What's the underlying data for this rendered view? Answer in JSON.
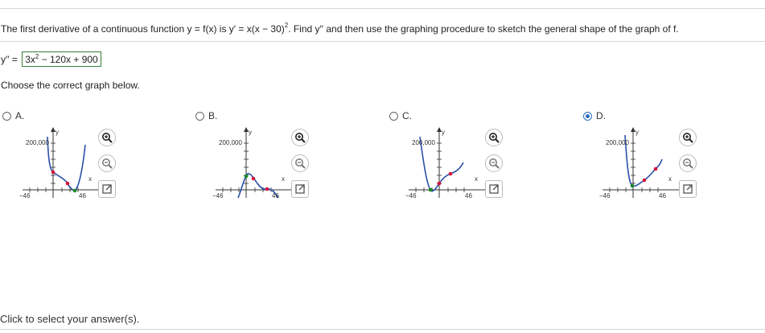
{
  "question": {
    "prefix": "The first derivative of a continuous function y = f(x) is y′ = x(x − 30)",
    "exponent": "2",
    "suffix": ". Find y′′ and then use the graphing procedure to sketch the general shape of the graph of f."
  },
  "answer": {
    "label": "y′′ =",
    "value_a": "3x",
    "value_exp": "2",
    "value_b": " − 120x + 900"
  },
  "instruction": "Choose the correct graph below.",
  "options": [
    {
      "letter": "A.",
      "selected": false,
      "ytick": "200,000",
      "xneg": "−46",
      "xpos": "46",
      "xlabel": "x",
      "ylabel": "y"
    },
    {
      "letter": "B.",
      "selected": false,
      "ytick": "200,000",
      "xneg": "−46",
      "xpos": "46",
      "xlabel": "x",
      "ylabel": "y"
    },
    {
      "letter": "C.",
      "selected": false,
      "ytick": "200,000",
      "xneg": "−46",
      "xpos": "46",
      "xlabel": "x",
      "ylabel": "y"
    },
    {
      "letter": "D.",
      "selected": true,
      "ytick": "200,000",
      "xneg": "−46",
      "xpos": "46",
      "xlabel": "x",
      "ylabel": "y"
    }
  ],
  "icons": {
    "zoom_in": "zoom-in-icon",
    "zoom_out": "zoom-out-icon",
    "expand": "expand-icon"
  },
  "colors": {
    "selected_radio": "#2a6ebb",
    "curve": "#2a4fa8",
    "point_red": "#d4143a",
    "point_green": "#1a8a2a"
  },
  "footer": "Click to select your answer(s)."
}
